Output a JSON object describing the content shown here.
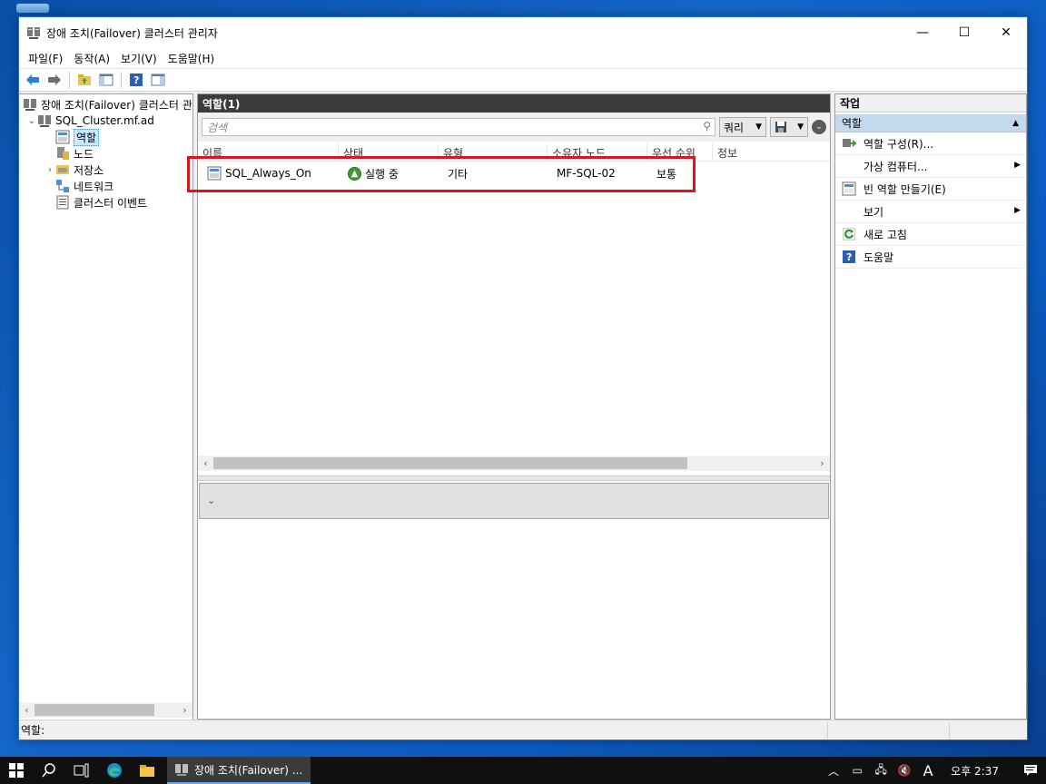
{
  "window": {
    "title": "장애 조치(Failover) 클러스터 관리자",
    "controls": {
      "minimize": "—",
      "maximize": "☐",
      "close": "✕"
    }
  },
  "menu": [
    "파일(F)",
    "동작(A)",
    "보기(V)",
    "도움말(H)"
  ],
  "tree": {
    "root": "장애 조치(Failover) 클러스터 관",
    "cluster": "SQL_Cluster.mf.ad",
    "items": [
      "역할",
      "노드",
      "저장소",
      "네트워크",
      "클러스터 이벤트"
    ]
  },
  "center": {
    "header": "역할(1)",
    "search_placeholder": "검색",
    "query_label": "쿼리",
    "columns": [
      "이름",
      "상태",
      "유형",
      "소유자 노드",
      "우선 순위",
      "정보"
    ],
    "rows": [
      {
        "name": "SQL_Always_On",
        "status": "실행 중",
        "type": "기타",
        "owner": "MF-SQL-02",
        "priority": "보통",
        "info": ""
      }
    ]
  },
  "actions": {
    "title": "작업",
    "section": "역할",
    "items": [
      {
        "label": "역할 구성(R)...",
        "icon": "configure-role-icon",
        "submenu": false
      },
      {
        "label": "가상 컴퓨터...",
        "icon": "",
        "submenu": true
      },
      {
        "label": "빈 역할 만들기(E)",
        "icon": "empty-role-icon",
        "submenu": false
      },
      {
        "label": "보기",
        "icon": "",
        "submenu": true
      },
      {
        "label": "새로 고침",
        "icon": "refresh-icon",
        "submenu": false
      },
      {
        "label": "도움말",
        "icon": "help-icon",
        "submenu": false
      }
    ]
  },
  "status": {
    "text": "역할:"
  },
  "taskbar": {
    "active_app": "장애 조치(Failover) ...",
    "clock": "오후 2:37",
    "ime": "A"
  },
  "colors": {
    "accent": "#0a4fa8",
    "highlight": "#e0141e",
    "selected": "#cce8ff"
  }
}
